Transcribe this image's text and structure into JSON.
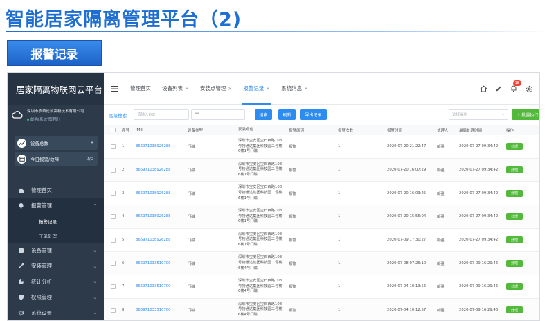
{
  "slide": {
    "title": "智能居家隔离管理平台（2)",
    "section": "报警记录"
  },
  "sidebar": {
    "app_title": "居家隔离物联网云平台",
    "company_name": "深圳市农黎伦凯高新技术有限公司",
    "company_status": "邮强[系统管理员]",
    "stats": [
      {
        "label": "设备总数",
        "value": "8"
      },
      {
        "label": "今日报警/故障",
        "value": "0/0"
      }
    ],
    "menu": [
      {
        "label": "管理首页",
        "icon": "home-icon"
      },
      {
        "label": "报警管理",
        "icon": "alarm-icon",
        "expanded": true,
        "children": [
          {
            "label": "报警记录",
            "current": true
          },
          {
            "label": "工单处理",
            "current": false
          }
        ]
      },
      {
        "label": "设备管理",
        "icon": "device-icon"
      },
      {
        "label": "安装管理",
        "icon": "install-icon"
      },
      {
        "label": "统计分析",
        "icon": "chart-icon"
      },
      {
        "label": "权限管理",
        "icon": "shield-icon"
      },
      {
        "label": "系统设置",
        "icon": "gear-icon"
      }
    ]
  },
  "header": {
    "tabs": [
      {
        "label": "管理首页",
        "closable": false,
        "active": false
      },
      {
        "label": "设备列表",
        "closable": true,
        "active": false
      },
      {
        "label": "安装点管理",
        "closable": true,
        "active": false
      },
      {
        "label": "报警记录",
        "closable": true,
        "active": true
      },
      {
        "label": "系统消息",
        "closable": true,
        "active": false
      }
    ],
    "close_glyph": "×",
    "notification_count": "18"
  },
  "toolbar": {
    "advanced_search": "高级搜索",
    "imei_placeholder": "请输入IMEI",
    "search_label": "搜索",
    "refresh_label": "刷新",
    "export_label": "导出记录",
    "op_select_placeholder": "选择操作",
    "batch_label": "批量执行"
  },
  "table": {
    "columns": [
      "序号",
      "IMEI",
      "设备类型",
      "安装点位",
      "报警原因",
      "报警次数",
      "报警时间",
      "处理人",
      "最后处理时间",
      "操作"
    ],
    "rows": [
      {
        "no": "1",
        "imei": "866971038926288",
        "type": "门磁",
        "loc": [
          "深圳市宝安区宝石西路108",
          "号物通达集团科技园二号楼",
          "6楼1号门磁"
        ],
        "reason": "报警",
        "count": "1",
        "time": "2020-07-20 21:22:47",
        "handler": "邮强",
        "last": "2020-07-27 09:34:42",
        "op": "处理"
      },
      {
        "no": "2",
        "imei": "866971038926288",
        "type": "门磁",
        "loc": [
          "深圳市宝安区宝石西路108",
          "号物通达集团科技园二号楼",
          "6楼1号门磁"
        ],
        "reason": "报警",
        "count": "1",
        "time": "2020-07-20 16:07:29",
        "handler": "邮强",
        "last": "2020-07-27 09:34:42",
        "op": "处理"
      },
      {
        "no": "3",
        "imei": "866971038926288",
        "type": "门磁",
        "loc": [
          "深圳市宝安区宝石西路108",
          "号物通达集团科技园二号楼",
          "6楼1号门磁"
        ],
        "reason": "报警",
        "count": "1",
        "time": "2020-07-20 16:03:25",
        "handler": "邮强",
        "last": "2020-07-27 09:34:42",
        "op": "处理"
      },
      {
        "no": "4",
        "imei": "866971038926288",
        "type": "门磁",
        "loc": [
          "深圳市宝安区宝石西路108",
          "号物通达集团科技园二号楼",
          "6楼1号门磁"
        ],
        "reason": "报警",
        "count": "1",
        "time": "2020-07-20 15:56:04",
        "handler": "邮强",
        "last": "2020-07-27 09:34:42",
        "op": "处理"
      },
      {
        "no": "5",
        "imei": "866971038926288",
        "type": "门磁",
        "loc": [
          "深圳市宝安区宝石西路108",
          "号物通达集团科技园二号楼",
          "6楼1号门磁"
        ],
        "reason": "报警",
        "count": "1",
        "time": "2020-07-09 17:30:27",
        "handler": "邮强",
        "last": "2020-07-27 09:34:42",
        "op": "处理"
      },
      {
        "no": "6",
        "imei": "866971033510700",
        "type": "门磁",
        "loc": [
          "深圳市宝安区宝石西路108",
          "号物通达集团科技园二号楼",
          "6楼4号门磁"
        ],
        "reason": "报警",
        "count": "1",
        "time": "2020-07-08 07:26:10",
        "handler": "邮强",
        "last": "2020-07-09 16:29:46",
        "op": "处理"
      },
      {
        "no": "7",
        "imei": "866971033510700",
        "type": "门磁",
        "loc": [
          "深圳市宝安区宝石西路108",
          "号物通达集团科技园二号楼",
          "6楼4号门磁"
        ],
        "reason": "报警",
        "count": "1",
        "time": "2020-07-04 10:13:56",
        "handler": "邮强",
        "last": "2020-07-09 16:29:46",
        "op": "处理"
      },
      {
        "no": "8",
        "imei": "866971033510700",
        "type": "门磁",
        "loc": [
          "深圳市宝安区宝石西路108",
          "号物通达集团科技园二号楼",
          "6楼4号门磁"
        ],
        "reason": "报警",
        "count": "1",
        "time": "2020-07-04 10:12:57",
        "handler": "邮强",
        "last": "2020-07-09 16:29:46",
        "op": "处理"
      }
    ]
  },
  "colors": {
    "primary": "#2d8cf0",
    "success": "#52b93a",
    "sidebar": "#2c3a4a",
    "title": "#1e6fd1"
  }
}
